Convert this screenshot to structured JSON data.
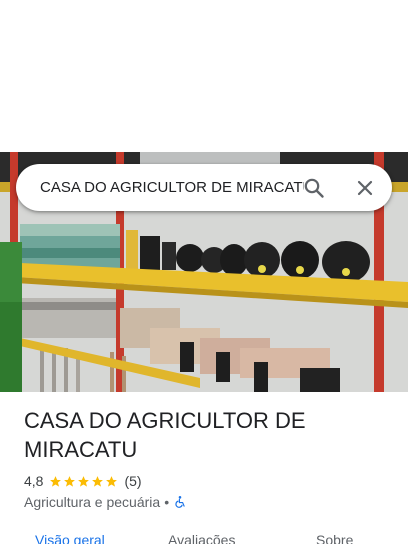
{
  "search": {
    "query": "CASA DO AGRICULTOR DE MIRACATU"
  },
  "place": {
    "name": "CASA DO AGRICULTOR DE MIRACATU",
    "rating": "4,8",
    "stars": 4.8,
    "reviews": "(5)",
    "category": "Agricultura e pecuária",
    "separator": "•"
  },
  "tabs": [
    {
      "label": "Visão geral",
      "active": true
    },
    {
      "label": "Avaliações",
      "active": false
    },
    {
      "label": "Sobre",
      "active": false
    }
  ],
  "colors": {
    "accent": "#1a73e8",
    "star": "#fbbc04",
    "accessibility": "#1a73e8"
  },
  "icons": {
    "search": "search-icon",
    "close": "close-icon",
    "accessibility": "wheelchair-accessible-icon"
  }
}
